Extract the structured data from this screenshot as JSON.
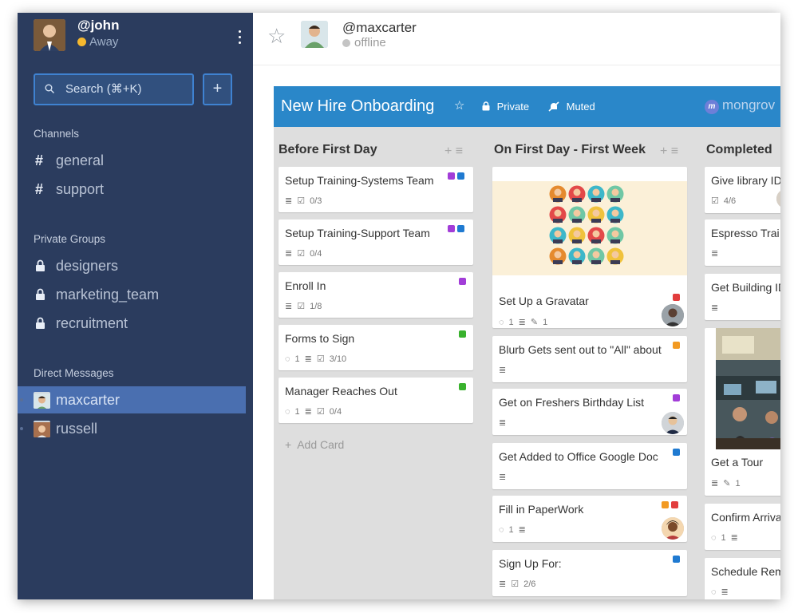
{
  "colors": {
    "sidebar": "#2b3c5e",
    "active_nav": "#4a6fb0",
    "board_header": "#2a87c9",
    "away": "#f5b82e"
  },
  "user": {
    "handle": "@john",
    "status": "Away"
  },
  "search": {
    "placeholder": "Search (⌘+K)"
  },
  "add_label": "+",
  "sections": {
    "channels": "Channels",
    "private_groups": "Private Groups",
    "direct_messages": "Direct Messages"
  },
  "channels": [
    {
      "glyph": "#",
      "name": "general"
    },
    {
      "glyph": "#",
      "name": "support"
    }
  ],
  "groups": [
    {
      "name": "designers"
    },
    {
      "name": "marketing_team"
    },
    {
      "name": "recruitment"
    }
  ],
  "dms": [
    {
      "name": "maxcarter",
      "active": true
    },
    {
      "name": "russell",
      "active": false
    }
  ],
  "room": {
    "name": "@maxcarter",
    "status": "offline"
  },
  "board": {
    "title": "New Hire Onboarding",
    "privacy": "Private",
    "muted": "Muted",
    "brand": "mongrov"
  },
  "lists": [
    {
      "title": "Before First Day",
      "cards": [
        {
          "title": "Setup Training-Systems Team",
          "checklist": "0/3"
        },
        {
          "title": "Setup Training-Support Team",
          "checklist": "0/4"
        },
        {
          "title": "Enroll In",
          "checklist": "1/8"
        },
        {
          "title": "Forms to Sign",
          "comments": "1",
          "checklist": "3/10"
        },
        {
          "title": "Manager Reaches Out",
          "comments": "1",
          "checklist": "0/4"
        }
      ],
      "add_card": "Add Card"
    },
    {
      "title": "On First Day - First Week",
      "cards": [
        {
          "title": "Set Up a Gravatar",
          "comments": "1",
          "attachments": "1"
        },
        {
          "title": "Blurb Gets sent out to \"All\" about"
        },
        {
          "title": "Get on Freshers Birthday List"
        },
        {
          "title": "Get Added to Office Google Doc"
        },
        {
          "title": "Fill in PaperWork",
          "comments": "1"
        },
        {
          "title": "Sign Up For:",
          "checklist": "2/6"
        }
      ]
    },
    {
      "title": "Completed",
      "cards": [
        {
          "title": "Give library ID",
          "checklist": "4/6"
        },
        {
          "title": "Espresso Trai"
        },
        {
          "title": "Get Building ID"
        },
        {
          "title": "Get a Tour",
          "attachments": "1"
        },
        {
          "title": "Confirm Arriva",
          "comments": "1"
        },
        {
          "title": "Schedule Rem"
        }
      ]
    }
  ]
}
